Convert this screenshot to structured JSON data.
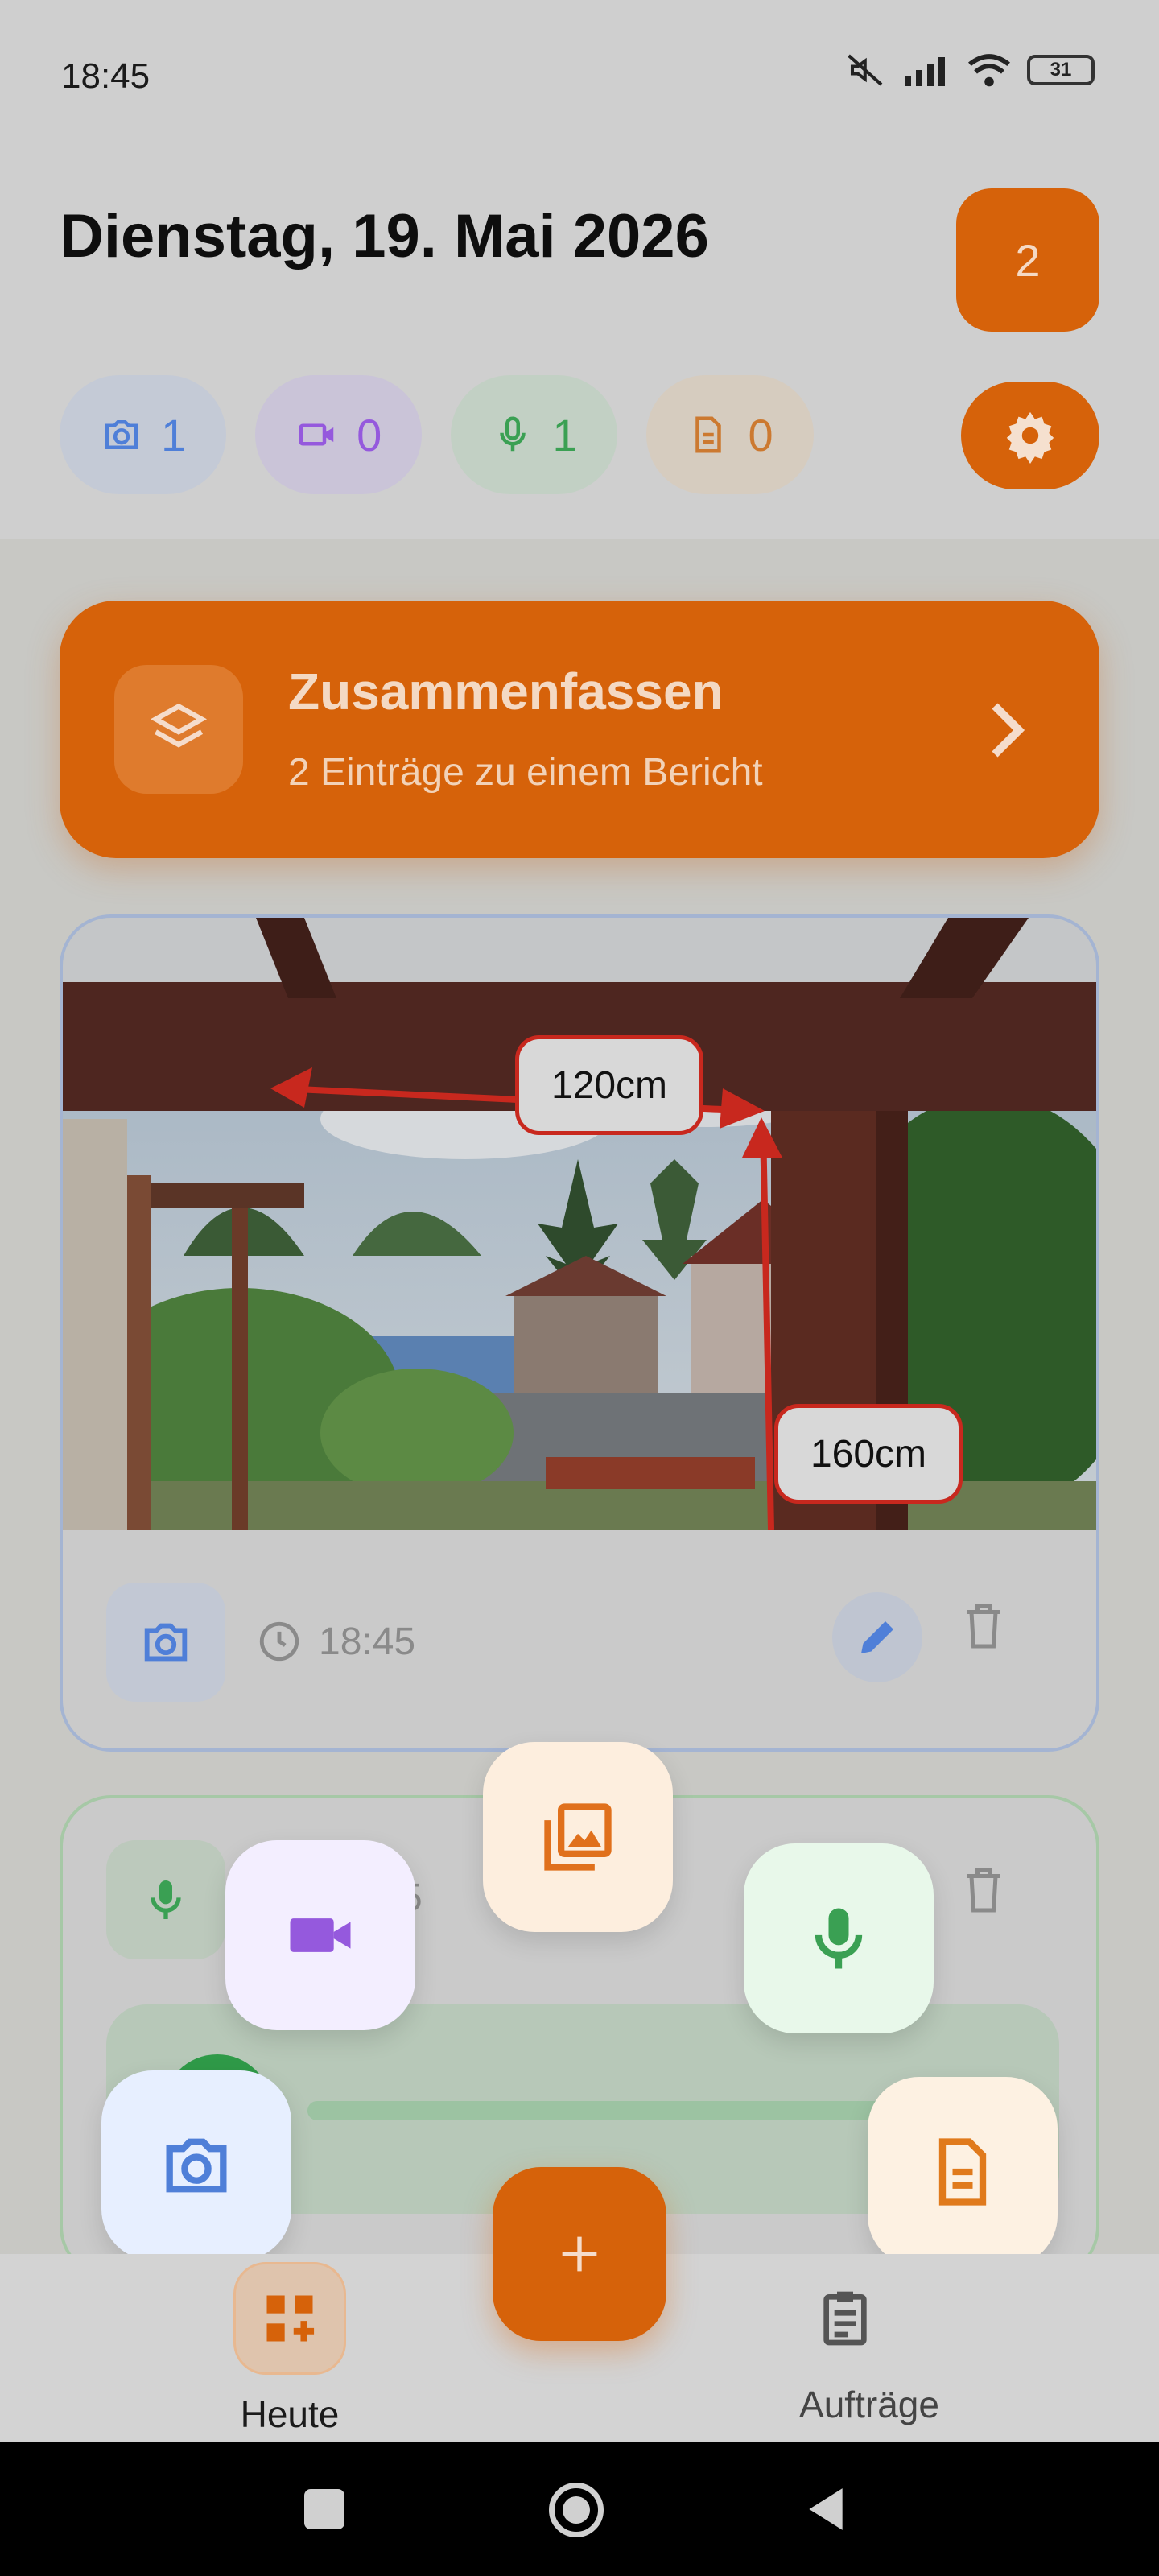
{
  "status_bar": {
    "time": "18:45",
    "battery": "31"
  },
  "header": {
    "date_title": "Dienstag, 19. Mai 2026",
    "count_badge": "2"
  },
  "stats": {
    "photo": "1",
    "video": "0",
    "audio": "1",
    "document": "0"
  },
  "summary": {
    "title": "Zusammenfassen",
    "subtitle": "2 Einträge zu einem Bericht"
  },
  "photo_entry": {
    "time": "18:45",
    "annotations": {
      "width": "120cm",
      "height": "160cm"
    },
    "border_color": "#a4b4d2"
  },
  "audio_entry": {
    "time_partial": "5"
  },
  "bottom_nav": {
    "today_label": "Heute",
    "orders_label": "Aufträge"
  },
  "colors": {
    "accent": "#d6620a",
    "photo": "#4f7fd8",
    "video": "#9559dd",
    "audio": "#3aa053",
    "document": "#cc7930"
  },
  "icons": [
    "camera-icon",
    "video-icon",
    "mic-icon",
    "document-icon",
    "gear-icon",
    "layers-icon",
    "chevron-right-icon",
    "clock-icon",
    "pencil-icon",
    "trash-icon",
    "gallery-icon",
    "plus-icon",
    "dashboard-add-icon",
    "clipboard-icon"
  ]
}
